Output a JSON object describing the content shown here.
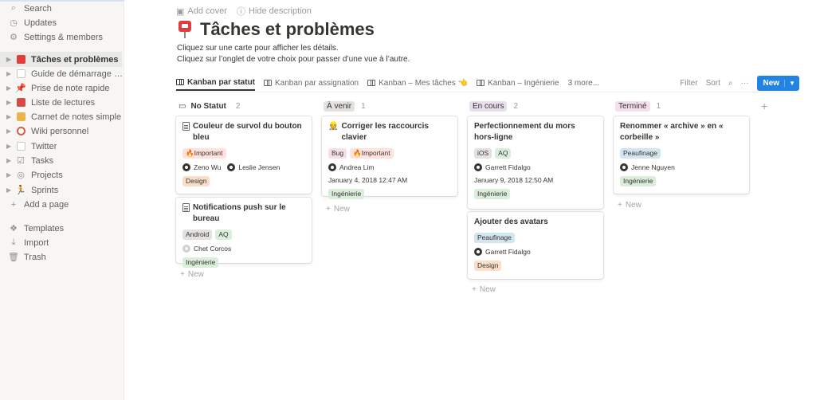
{
  "sidebar": {
    "items": [
      {
        "label": "Search",
        "icon": "search-icon",
        "glyph": "⌕"
      },
      {
        "label": "Updates",
        "icon": "clock-icon",
        "glyph": "◷"
      },
      {
        "label": "Settings & members",
        "icon": "gear-icon",
        "glyph": "⚙"
      }
    ],
    "pages": [
      {
        "label": "Tâches et problèmes",
        "icon": "pushpin-icon",
        "color": "#e03e3e"
      },
      {
        "label": "Guide de démarrage sur...",
        "icon": "page-icon",
        "color": "#c9c8c4"
      },
      {
        "label": "Prise de note rapide",
        "icon": "pin-icon",
        "color": "#e03e3e"
      },
      {
        "label": "Liste de lectures",
        "icon": "book-icon",
        "color": "#d44c47"
      },
      {
        "label": "Carnet de notes simple",
        "icon": "notebook-icon",
        "color": "#e9b44c"
      },
      {
        "label": "Wiki personnel",
        "icon": "compass-icon",
        "color": "#d45b4b"
      },
      {
        "label": "Twitter",
        "icon": "page-icon",
        "color": "#c9c8c4"
      },
      {
        "label": "Tasks",
        "icon": "checkbox-icon",
        "color": "#9b9a97"
      },
      {
        "label": "Projects",
        "icon": "target-icon",
        "color": "#9b9a97"
      },
      {
        "label": "Sprints",
        "icon": "runner-icon",
        "color": "#9b9a97"
      }
    ],
    "add_page": "Add a page",
    "bottom": [
      {
        "label": "Templates",
        "icon": "templates-icon",
        "glyph": "❖"
      },
      {
        "label": "Import",
        "icon": "import-icon",
        "glyph": "⤓"
      },
      {
        "label": "Trash",
        "icon": "trash-icon",
        "glyph": "🗑"
      }
    ]
  },
  "header": {
    "add_cover": "Add cover",
    "hide_description": "Hide description",
    "title": "Tâches et problèmes",
    "description_line1": "Cliquez sur une carte pour afficher les détails.",
    "description_line2": "Cliquez sur l’onglet de votre choix pour passer d’une vue à l’autre."
  },
  "tabs": [
    {
      "label": "Kanban par statut"
    },
    {
      "label": "Kanban par assignation"
    },
    {
      "label": "Kanban – Mes tâches 👈"
    },
    {
      "label": "Kanban – Ingénierie"
    },
    {
      "label": "3 more..."
    }
  ],
  "toolbar": {
    "filter": "Filter",
    "sort": "Sort",
    "more": "···",
    "new": "New"
  },
  "columns": [
    {
      "name": "No Statut",
      "count": "2",
      "color": "#ffffff"
    },
    {
      "name": "À venir",
      "count": "1",
      "color": "#e3e2e0"
    },
    {
      "name": "En cours",
      "count": "2",
      "color": "#e8deee"
    },
    {
      "name": "Terminé",
      "count": "1",
      "color": "#f4dfeb"
    }
  ],
  "tag_colors": {
    "important": "#ffe2dd",
    "design": "#fadec9",
    "ingenierie": "#dbeddb",
    "gray": "#e3e2e0",
    "aq": "#dbeddb",
    "peaufinage": "#d3e5ef",
    "bug": "#f4dfeb"
  },
  "cards": {
    "c1": {
      "title": "Couleur de survol du bouton bleu",
      "tag": "🔥Important",
      "p1": "Zeno Wu",
      "p2": "Leslie Jensen",
      "team": "Design"
    },
    "c2": {
      "title": "Notifications push sur le bureau",
      "tag1": "Android",
      "tag2": "AQ",
      "p1": "Chet Corcos",
      "team": "Ingénierie"
    },
    "c3": {
      "title": "Corriger les raccourcis clavier",
      "tag1": "Bug",
      "tag2": "🔥Important",
      "p1": "Andrea Lim",
      "date": "January 4, 2018 12:47 AM",
      "team": "Ingénierie"
    },
    "c4": {
      "title": "Perfectionnement du mors hors-ligne",
      "tag1": "iOS",
      "tag2": "AQ",
      "p1": "Garrett Fidalgo",
      "date": "January 9, 2018 12:50 AM",
      "team": "Ingénierie"
    },
    "c5": {
      "title": "Ajouter des avatars",
      "tag": "Peaufinage",
      "p1": "Garrett Fidalgo",
      "team": "Design"
    },
    "c6": {
      "title": "Renommer « archive » en « corbeille »",
      "tag": "Peaufinage",
      "p1": "Jenne Nguyen",
      "team": "Ingénierie"
    }
  },
  "new_label": "New"
}
